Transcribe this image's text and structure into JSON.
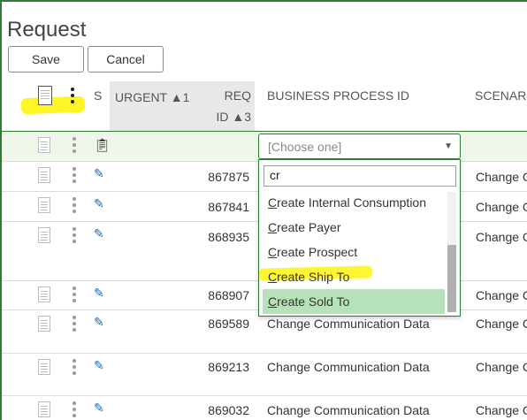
{
  "page": {
    "title": "Request"
  },
  "toolbar": {
    "save_label": "Save",
    "cancel_label": "Cancel"
  },
  "columns": {
    "s": "S",
    "urgent": "URGENT",
    "urgent_sort": "▲1",
    "req_line1": "REQ",
    "req_line2": "ID",
    "req_sort": "▲3",
    "business_process_id": "BUSINESS PROCESS ID",
    "scenario": "SCENAR"
  },
  "combo": {
    "placeholder": "[Choose one]",
    "filter_value": "cr"
  },
  "options": [
    {
      "first": "C",
      "rest": "reate Internal Consumption"
    },
    {
      "first": "C",
      "rest": "reate Payer"
    },
    {
      "first": "C",
      "rest": "reate Prospect"
    },
    {
      "first": "C",
      "rest": "reate Ship To"
    },
    {
      "first": "C",
      "rest": "reate Sold To"
    }
  ],
  "rows": [
    {
      "req_id": "867875",
      "bpid": "",
      "scenario": "Change C"
    },
    {
      "req_id": "867841",
      "bpid": "",
      "scenario": "Change C"
    },
    {
      "req_id": "868935",
      "bpid": "",
      "scenario": "Change C"
    },
    {
      "req_id": "868907",
      "bpid": "",
      "scenario": "Change C"
    },
    {
      "req_id": "869589",
      "bpid": "Change Communication Data",
      "scenario": "Change C"
    },
    {
      "req_id": "869213",
      "bpid": "Change Communication Data",
      "scenario": "Change C"
    },
    {
      "req_id": "869032",
      "bpid": "Change Communication Data",
      "scenario": "Change C"
    }
  ],
  "icons": {
    "header_doc": "document-icon",
    "header_menu": "kebab-menu-icon",
    "status_new": "clipboard-icon",
    "status_edit": "edit-document-icon"
  },
  "colors": {
    "accent": "#2e7d32",
    "highlight": "#fff200",
    "selected_option": "#b7e1b9",
    "header_bg": "#e8e8e8"
  }
}
